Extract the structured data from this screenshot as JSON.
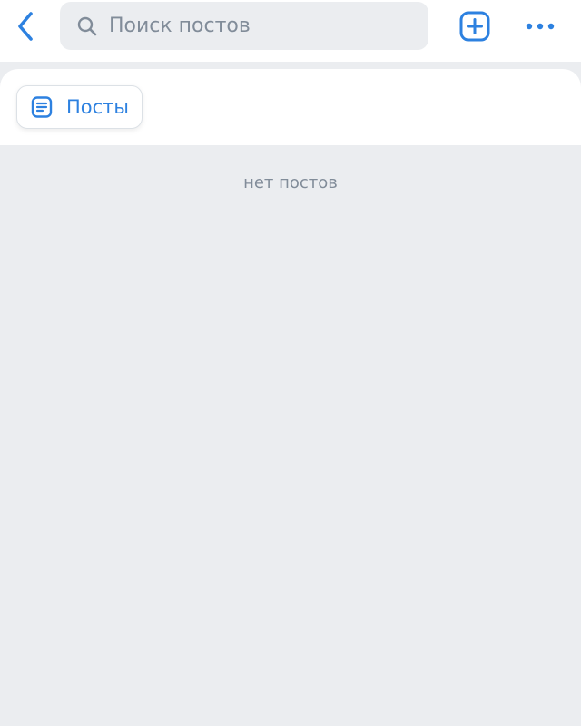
{
  "colors": {
    "accent": "#2d81e0",
    "background": "#ebedf0",
    "surface": "#ffffff",
    "secondary_text": "#818c99"
  },
  "header": {
    "back_icon": "chevron-left-icon",
    "search": {
      "icon": "search-icon",
      "placeholder": "Поиск постов",
      "value": ""
    },
    "add_icon": "plus-square-icon",
    "more_icon": "more-horizontal-icon"
  },
  "tabs": [
    {
      "label": "Посты",
      "icon": "document-text-icon",
      "selected": true
    }
  ],
  "content": {
    "empty_message": "нет постов"
  }
}
